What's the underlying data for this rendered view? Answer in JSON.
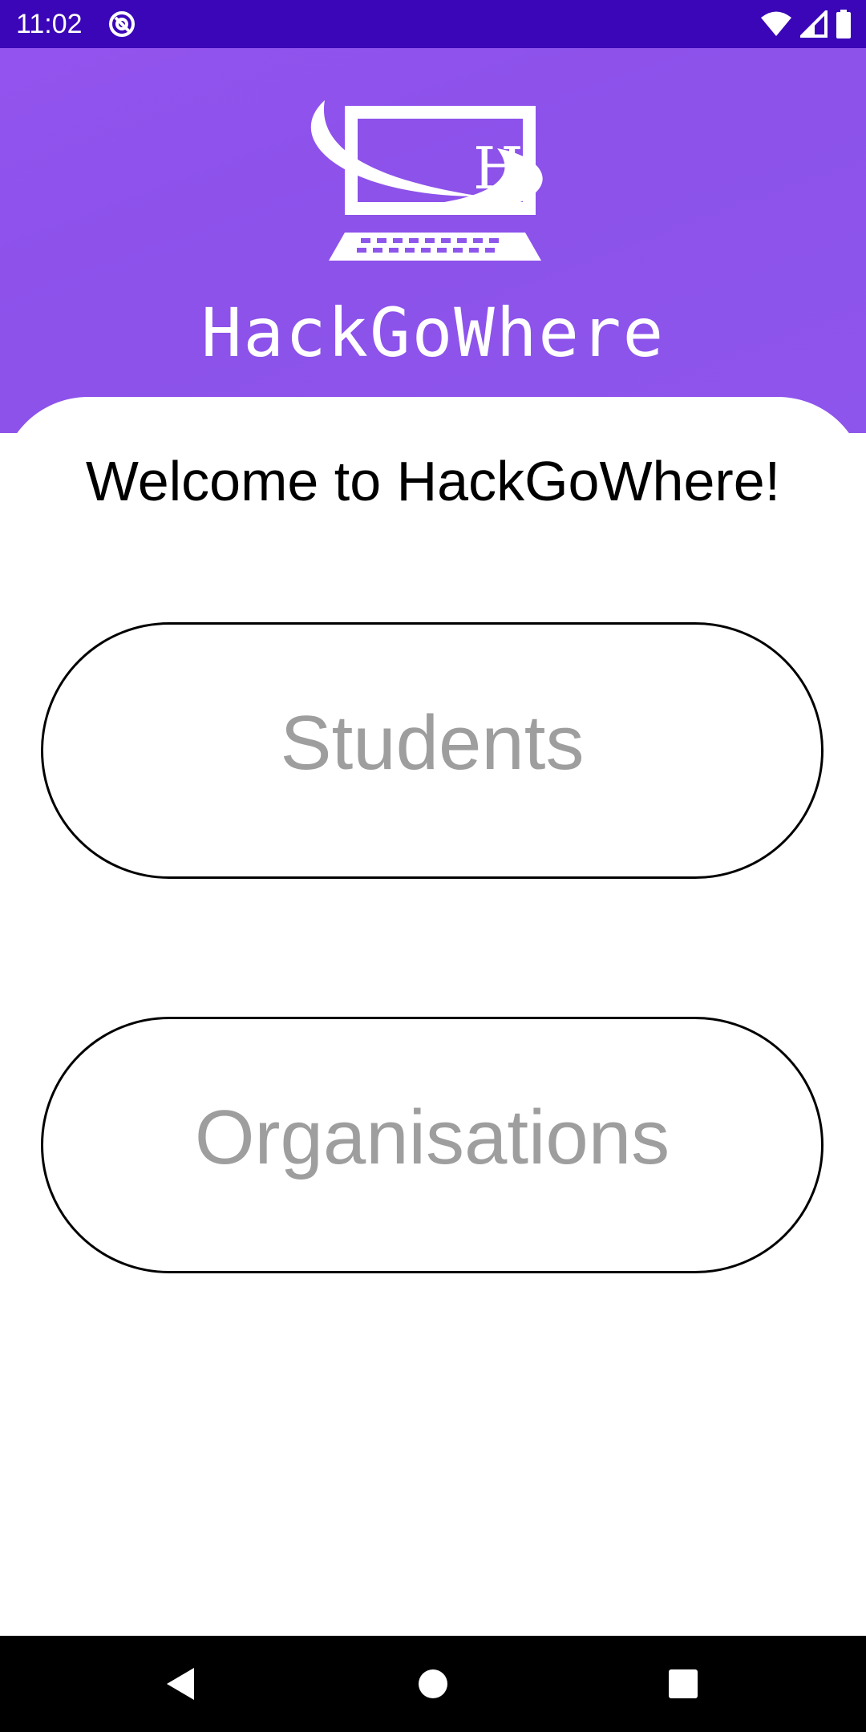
{
  "status_bar": {
    "time": "11:02",
    "app_icon": "at-sign-icon",
    "icons": [
      "wifi-icon",
      "cell-signal-icon",
      "battery-icon"
    ],
    "background_color": "#3a06b8"
  },
  "header": {
    "logo_icon": "computer-logo-icon",
    "logo_letter": "H",
    "app_name": "HackGoWhere",
    "gradient_color": "#8e55ec"
  },
  "main": {
    "welcome_text": "Welcome to HackGoWhere!",
    "buttons": [
      {
        "label": "Students"
      },
      {
        "label": "Organisations"
      }
    ],
    "button_text_color": "#9e9e9e"
  },
  "nav_bar": {
    "icons": [
      "back-triangle-icon",
      "home-circle-icon",
      "recents-square-icon"
    ]
  }
}
